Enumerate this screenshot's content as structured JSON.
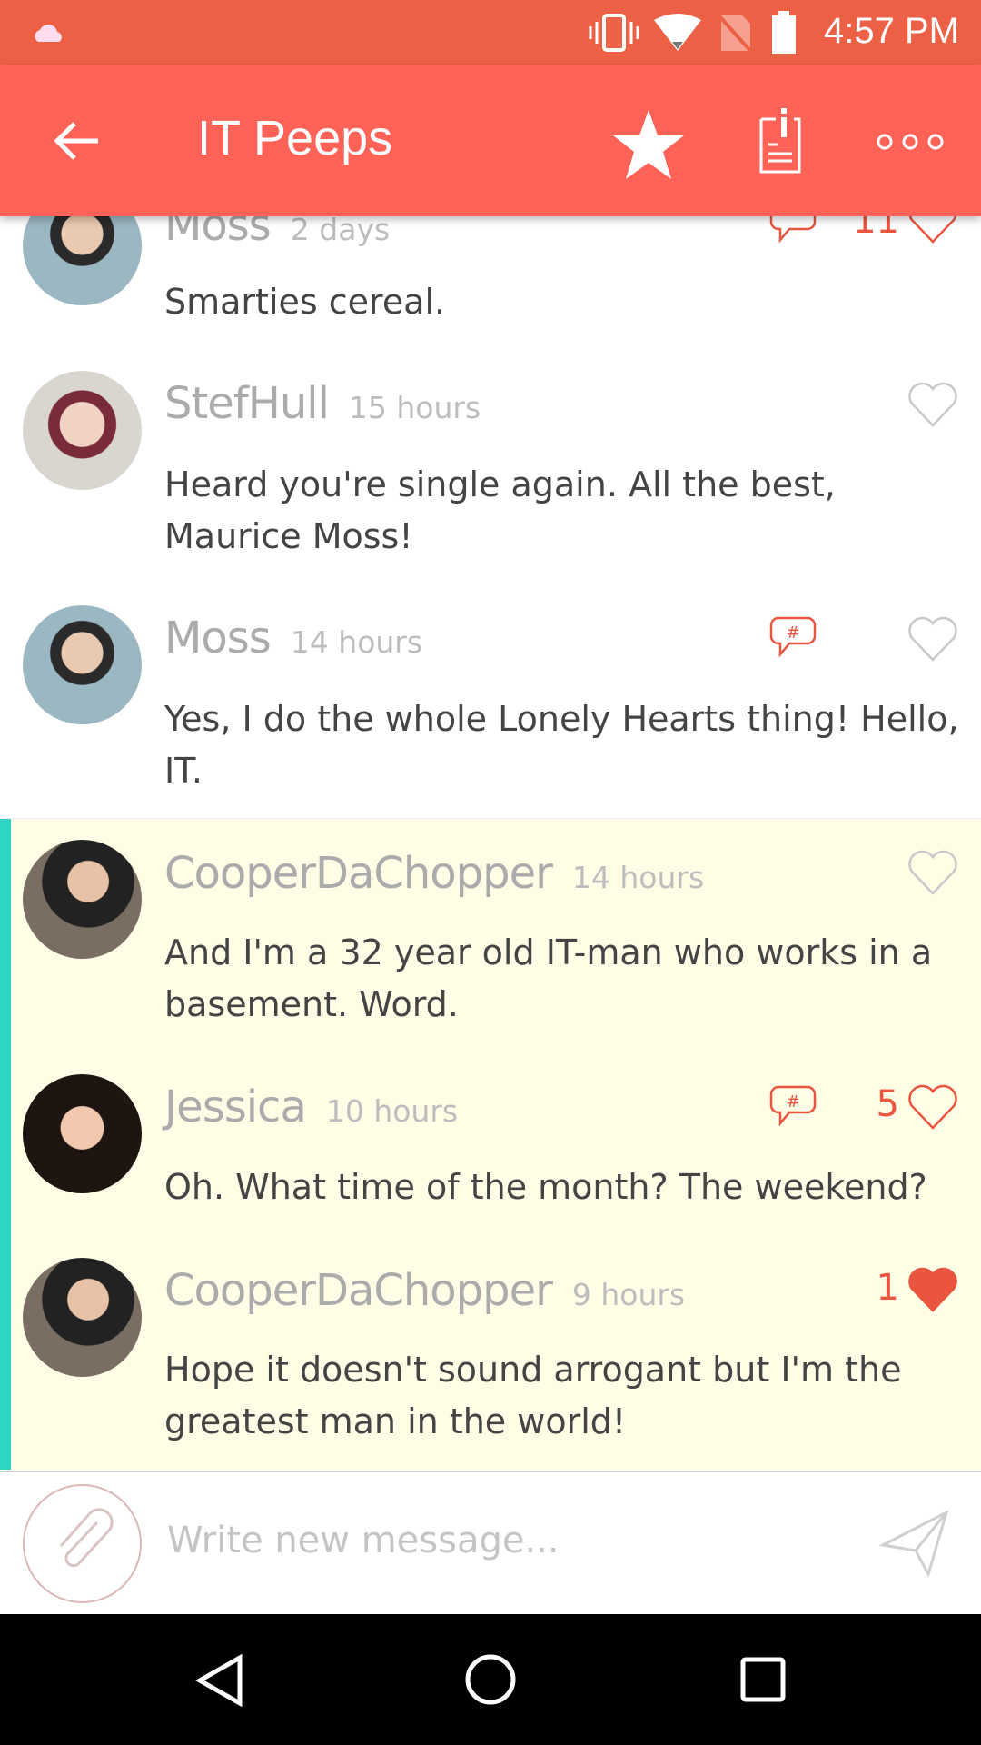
{
  "status_bar": {
    "time": "4:57 PM"
  },
  "toolbar": {
    "title": "IT Peeps"
  },
  "colors": {
    "accent": "#FF6357",
    "status": "#EC6146",
    "highlight": "#FFFDE6",
    "thread_bar": "#2ED5C5",
    "like": "#E9553F"
  },
  "messages": [
    {
      "name": "Moss",
      "time": "2 days",
      "text": "Smarties cereal.",
      "likes": "11",
      "has_comment": true
    },
    {
      "name": "StefHull",
      "time": "15 hours",
      "text": "Heard you're single again. All the best, Maurice Moss!"
    },
    {
      "name": "Moss",
      "time": "14 hours",
      "text": "Yes, I do the whole Lonely Hearts thing! Hello, IT.",
      "has_comment": true
    },
    {
      "name": "CooperDaChopper",
      "time": "14 hours",
      "text": "And I'm a 32 year old IT-man who works in a basement. Word."
    },
    {
      "name": "Jessica",
      "time": "10 hours",
      "text": "Oh. What time of the month? The weekend?",
      "likes": "5",
      "has_comment": true
    },
    {
      "name": "CooperDaChopper",
      "time": "9 hours",
      "text": "Hope it doesn't sound arrogant but I'm the greatest man in the world!",
      "likes": "1",
      "liked": true
    }
  ],
  "composer": {
    "placeholder": "Write new message..."
  }
}
